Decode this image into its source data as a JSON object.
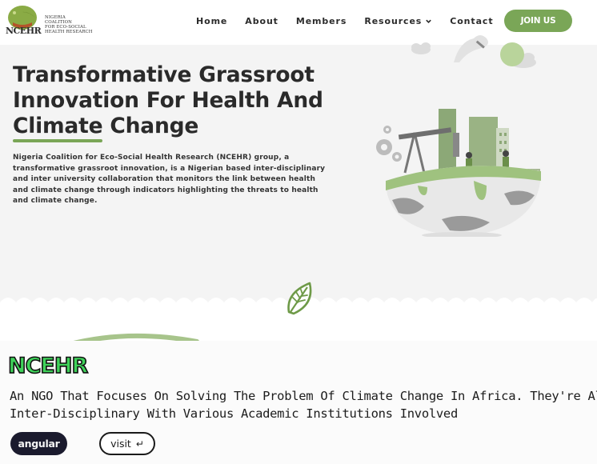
{
  "header": {
    "logo": {
      "wordmark": "NCEHR",
      "lines": [
        "NIGERIA",
        "COALITION",
        "FOR ECO-SOCIAL",
        "HEALTH RESEARCH"
      ]
    },
    "nav": [
      {
        "label": "Home"
      },
      {
        "label": "About"
      },
      {
        "label": "Members"
      },
      {
        "label": "Resources",
        "has_dropdown": true
      },
      {
        "label": "Contact"
      }
    ],
    "join_label": "JOIN US"
  },
  "hero": {
    "title_lines": [
      "Transformative Grassroot",
      "Innovation For Health And"
    ],
    "title_highlight": "Climate",
    "title_tail": " Change",
    "description": "Nigeria Coalition for Eco-Social Health Research (NCEHR) group, a transformative grassroot innovation, is a Nigerian based inter-disciplinary and inter university collaboration that monitors the link between health and climate change through indicators highlighting the threats to health and climate change."
  },
  "project_card": {
    "name": "NCEHR",
    "tagline_lines": [
      "An NGO That Focuses On Solving The Problem Of Climate Change In Africa. They're Also",
      "Inter-Disciplinary With Various Academic Institutions Involved"
    ],
    "tech_tag": "angular",
    "visit_label": "visit",
    "visit_icon": "return-arrow-icon"
  },
  "colors": {
    "accent_green": "#7aa657",
    "brand_neon": "#3fd25a",
    "dark_pill": "#1b1b2e"
  }
}
